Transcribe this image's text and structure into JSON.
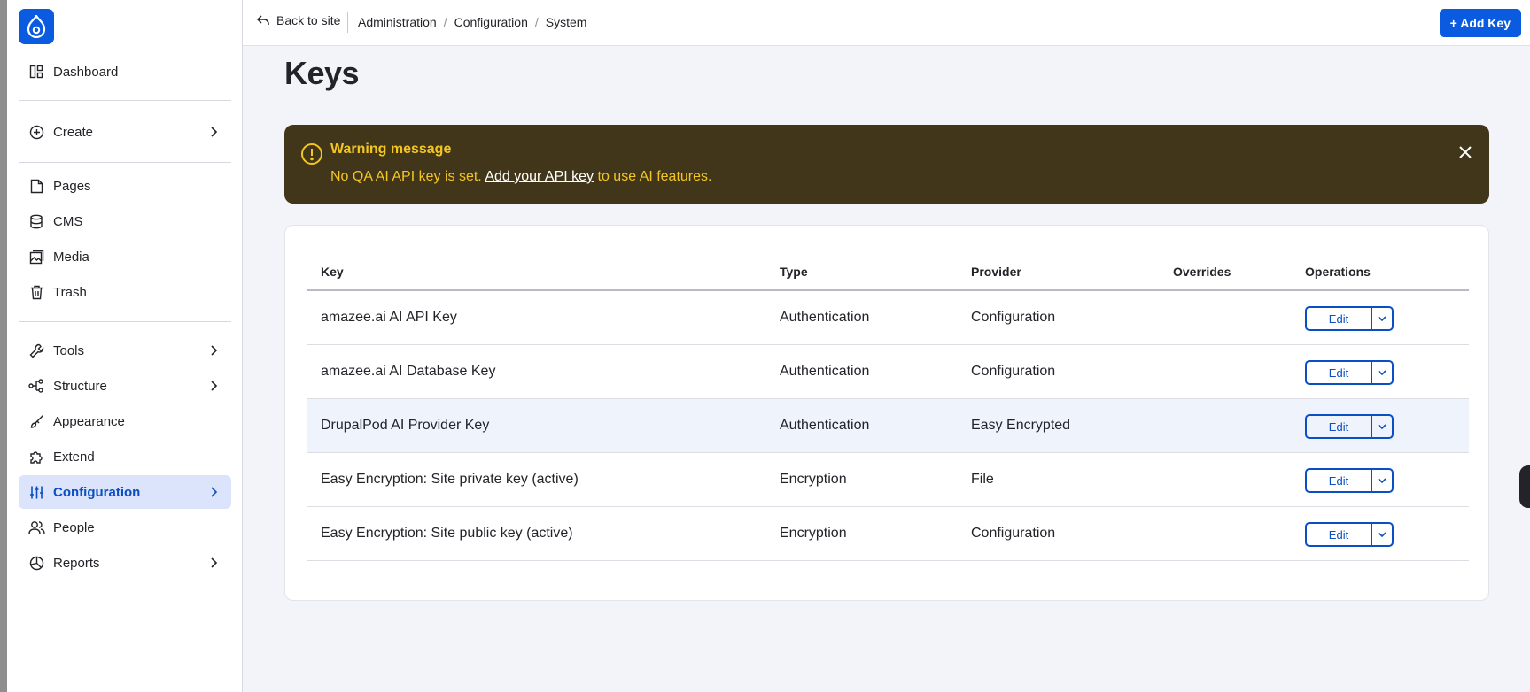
{
  "sidebar": {
    "items": [
      {
        "label": "Dashboard",
        "icon": "dashboard-icon"
      },
      {
        "label": "Create",
        "icon": "plus-circle-icon"
      },
      {
        "label": "Pages",
        "icon": "page-icon"
      },
      {
        "label": "CMS",
        "icon": "database-icon"
      },
      {
        "label": "Media",
        "icon": "media-icon"
      },
      {
        "label": "Trash",
        "icon": "trash-icon"
      },
      {
        "label": "Tools",
        "icon": "wrench-icon"
      },
      {
        "label": "Structure",
        "icon": "structure-icon"
      },
      {
        "label": "Appearance",
        "icon": "brush-icon"
      },
      {
        "label": "Extend",
        "icon": "puzzle-icon"
      },
      {
        "label": "Configuration",
        "icon": "sliders-icon"
      },
      {
        "label": "People",
        "icon": "people-icon"
      },
      {
        "label": "Reports",
        "icon": "chart-icon"
      }
    ]
  },
  "topbar": {
    "back_label": "Back to site",
    "breadcrumbs": [
      "Administration",
      "Configuration",
      "System"
    ],
    "add_key_label": "+ Add Key"
  },
  "page": {
    "title": "Keys"
  },
  "warning": {
    "title": "Warning message",
    "text_before": "No QA AI API key is set.",
    "link": "Add your API key",
    "text_after": "to use AI features."
  },
  "table": {
    "headers": [
      "Key",
      "Type",
      "Provider",
      "Overrides",
      "Operations"
    ],
    "rows": [
      {
        "key": "amazee.ai AI API Key",
        "type": "Authentication",
        "provider": "Configuration",
        "overrides": "",
        "op": "Edit"
      },
      {
        "key": "amazee.ai AI Database Key",
        "type": "Authentication",
        "provider": "Configuration",
        "overrides": "",
        "op": "Edit"
      },
      {
        "key": "DrupalPod AI Provider Key",
        "type": "Authentication",
        "provider": "Easy Encrypted",
        "overrides": "",
        "op": "Edit"
      },
      {
        "key": "Easy Encryption: Site private key (active)",
        "type": "Encryption",
        "provider": "File",
        "overrides": "",
        "op": "Edit"
      },
      {
        "key": "Easy Encryption: Site public key (active)",
        "type": "Encryption",
        "provider": "Configuration",
        "overrides": "",
        "op": "Edit"
      }
    ]
  },
  "colors": {
    "accent": "#0a5be0",
    "warning_bg": "#413619",
    "warning_text": "#f3c623",
    "active_bg": "#dbe4fb"
  }
}
